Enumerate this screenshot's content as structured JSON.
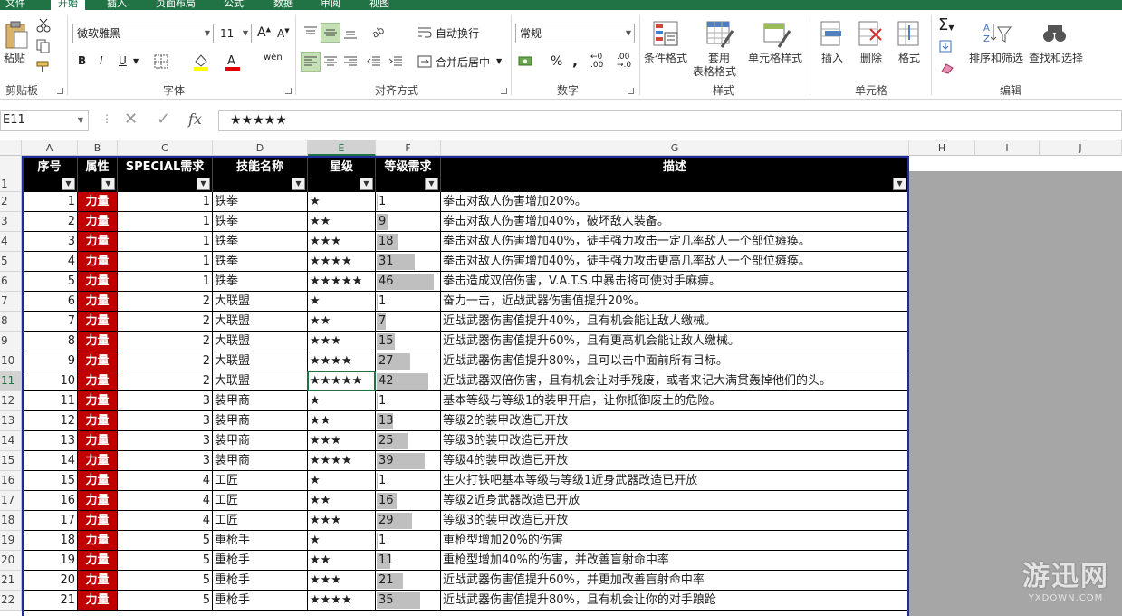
{
  "tabs": [
    "文件",
    "开始",
    "插入",
    "页面布局",
    "公式",
    "数据",
    "审阅",
    "视图"
  ],
  "ribbon": {
    "clipboard": {
      "paste": "粘贴",
      "label": "剪贴板"
    },
    "font": {
      "name": "微软雅黑",
      "size": "11",
      "label": "字体",
      "bold": "B",
      "italic": "I",
      "underline": "U"
    },
    "align": {
      "wrap": "自动换行",
      "merge": "合并后居中",
      "label": "对齐方式"
    },
    "number": {
      "format": "常规",
      "label": "数字",
      "percent": "%",
      "comma": ","
    },
    "styles": {
      "cond": "条件格式",
      "table1": "套用",
      "table2": "表格格式",
      "cell": "单元格样式",
      "label": "样式"
    },
    "cells": {
      "insert": "插入",
      "delete": "删除",
      "format": "格式",
      "label": "单元格"
    },
    "editing": {
      "sort": "排序和筛选",
      "find": "查找和选择",
      "label": "编辑"
    }
  },
  "formula_bar": {
    "name_box": "E11",
    "content": "★★★★★",
    "fx": "fx"
  },
  "columns": [
    "A",
    "B",
    "C",
    "D",
    "E",
    "F",
    "G",
    "H",
    "I",
    "J"
  ],
  "headers": [
    "序号",
    "属性",
    "SPECIAL需求",
    "技能名称",
    "星级",
    "等级需求",
    "描述"
  ],
  "rows": [
    {
      "r": "2",
      "id": 1,
      "attr": "力量",
      "special": 1,
      "name": "铁拳",
      "stars": "★",
      "level": 1,
      "desc": "拳击对敌人伤害增加20%。"
    },
    {
      "r": "3",
      "id": 2,
      "attr": "力量",
      "special": 1,
      "name": "铁拳",
      "stars": "★★",
      "level": 9,
      "desc": "拳击对敌人伤害增加40%，破坏敌人装备。"
    },
    {
      "r": "4",
      "id": 3,
      "attr": "力量",
      "special": 1,
      "name": "铁拳",
      "stars": "★★★",
      "level": 18,
      "desc": "拳击对敌人伤害增加40%，徒手强力攻击一定几率敌人一个部位瘫痪。"
    },
    {
      "r": "5",
      "id": 4,
      "attr": "力量",
      "special": 1,
      "name": "铁拳",
      "stars": "★★★★",
      "level": 31,
      "desc": "拳击对敌人伤害增加40%，徒手强力攻击更高几率敌人一个部位瘫痪。"
    },
    {
      "r": "6",
      "id": 5,
      "attr": "力量",
      "special": 1,
      "name": "铁拳",
      "stars": "★★★★★",
      "level": 46,
      "desc": "拳击造成双倍伤害，V.A.T.S.中暴击将可使对手麻痹。"
    },
    {
      "r": "7",
      "id": 6,
      "attr": "力量",
      "special": 2,
      "name": "大联盟",
      "stars": "★",
      "level": 1,
      "desc": "奋力一击，近战武器伤害值提升20%。"
    },
    {
      "r": "8",
      "id": 7,
      "attr": "力量",
      "special": 2,
      "name": "大联盟",
      "stars": "★★",
      "level": 7,
      "desc": "近战武器伤害值提升40%，且有机会能让敌人缴械。"
    },
    {
      "r": "9",
      "id": 8,
      "attr": "力量",
      "special": 2,
      "name": "大联盟",
      "stars": "★★★",
      "level": 15,
      "desc": "近战武器伤害值提升60%，且有更高机会能让敌人缴械。"
    },
    {
      "r": "10",
      "id": 9,
      "attr": "力量",
      "special": 2,
      "name": "大联盟",
      "stars": "★★★★",
      "level": 27,
      "desc": "近战武器伤害值提升80%，且可以击中面前所有目标。"
    },
    {
      "r": "11",
      "id": 10,
      "attr": "力量",
      "special": 2,
      "name": "大联盟",
      "stars": "★★★★★",
      "level": 42,
      "desc": "近战武器双倍伤害，且有机会让对手残废，或者来记大满贯轰掉他们的头。"
    },
    {
      "r": "12",
      "id": 11,
      "attr": "力量",
      "special": 3,
      "name": "装甲商",
      "stars": "★",
      "level": 1,
      "desc": "基本等级与等级1的装甲开启，让你抵御废土的危险。"
    },
    {
      "r": "13",
      "id": 12,
      "attr": "力量",
      "special": 3,
      "name": "装甲商",
      "stars": "★★",
      "level": 13,
      "desc": "等级2的装甲改造已开放"
    },
    {
      "r": "14",
      "id": 13,
      "attr": "力量",
      "special": 3,
      "name": "装甲商",
      "stars": "★★★",
      "level": 25,
      "desc": "等级3的装甲改造已开放"
    },
    {
      "r": "15",
      "id": 14,
      "attr": "力量",
      "special": 3,
      "name": "装甲商",
      "stars": "★★★★",
      "level": 39,
      "desc": "等级4的装甲改造已开放"
    },
    {
      "r": "16",
      "id": 15,
      "attr": "力量",
      "special": 4,
      "name": "工匠",
      "stars": "★",
      "level": 1,
      "desc": "生火打铁吧基本等级与等级1近身武器改造已开放"
    },
    {
      "r": "17",
      "id": 16,
      "attr": "力量",
      "special": 4,
      "name": "工匠",
      "stars": "★★",
      "level": 16,
      "desc": "等级2近身武器改造已开放"
    },
    {
      "r": "18",
      "id": 17,
      "attr": "力量",
      "special": 4,
      "name": "工匠",
      "stars": "★★★",
      "level": 29,
      "desc": "等级3的装甲改造已开放"
    },
    {
      "r": "19",
      "id": 18,
      "attr": "力量",
      "special": 5,
      "name": "重枪手",
      "stars": "★",
      "level": 1,
      "desc": "重枪型增加20%的伤害"
    },
    {
      "r": "20",
      "id": 19,
      "attr": "力量",
      "special": 5,
      "name": "重枪手",
      "stars": "★★",
      "level": 11,
      "desc": "重枪型增加40%的伤害，并改善盲射命中率"
    },
    {
      "r": "21",
      "id": 20,
      "attr": "力量",
      "special": 5,
      "name": "重枪手",
      "stars": "★★★",
      "level": 21,
      "desc": "近战武器伤害值提升60%，并更加改善盲射命中率"
    },
    {
      "r": "22",
      "id": 21,
      "attr": "力量",
      "special": 5,
      "name": "重枪手",
      "stars": "★★★★",
      "level": 35,
      "desc": "近战武器伤害值提升80%，且有机会让你的对手踉跄"
    }
  ],
  "selected_row": "11",
  "selected_col": "E",
  "databar_max": 50,
  "watermark": {
    "main": "游迅网",
    "sub": "YXDOWN.COM"
  },
  "colors": {
    "accent": "#217346",
    "attr_bg": "#c00000",
    "databar": "#bfbfbf"
  }
}
